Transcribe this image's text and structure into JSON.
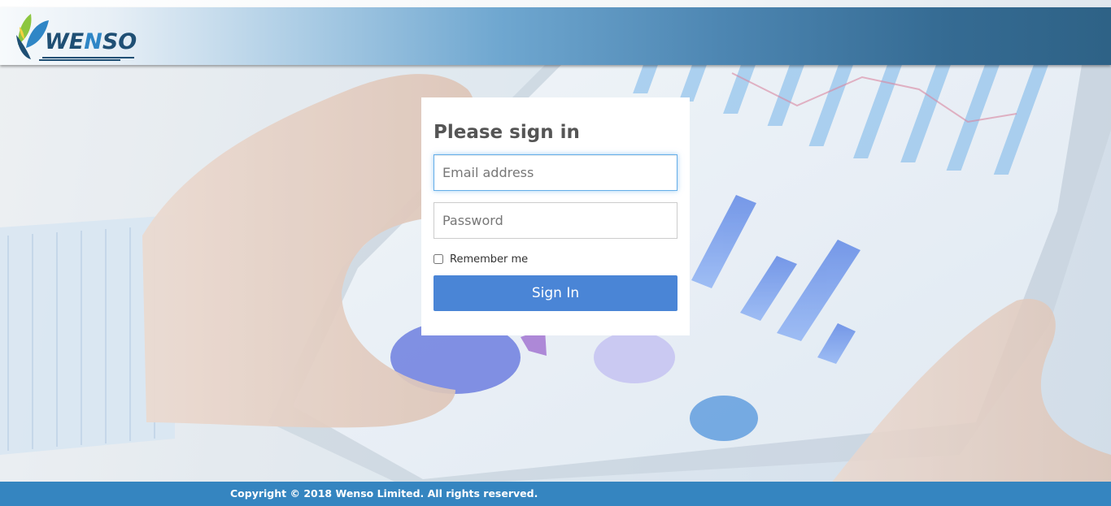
{
  "brand": {
    "name_part1": "WE",
    "name_part2": "N",
    "name_part3": "SO"
  },
  "login": {
    "title": "Please sign in",
    "email_placeholder": "Email address",
    "email_value": "",
    "password_placeholder": "Password",
    "password_value": "",
    "remember_label": "Remember me",
    "remember_checked": false,
    "submit_label": "Sign In"
  },
  "footer": {
    "copyright": "Copyright © 2018 Wenso Limited. All rights reserved."
  },
  "colors": {
    "header_dark": "#2e6286",
    "button": "#4a85d6",
    "footer": "#3585c0",
    "focus_border": "#66afe9"
  },
  "icons": {
    "logo": "leaf-logo-icon"
  }
}
